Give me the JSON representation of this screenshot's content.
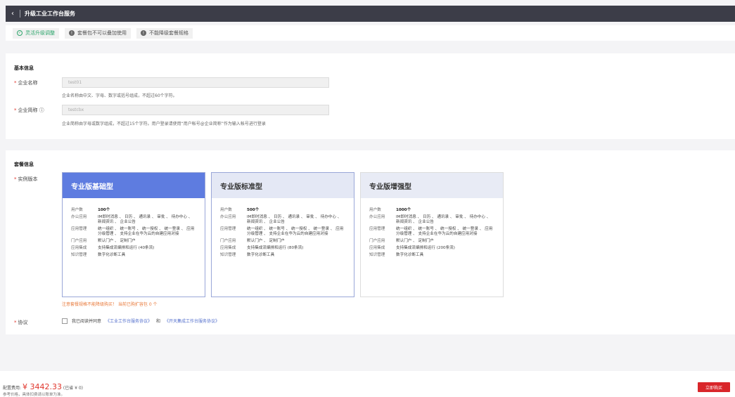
{
  "header": {
    "back_icon": "chevron-left-icon",
    "title": "升级工业工作台服务"
  },
  "tags": [
    {
      "label": "灵活升级调整",
      "icon": "✓"
    },
    {
      "label": "套餐包不可以叠加使用",
      "icon": "!"
    },
    {
      "label": "不能降级套餐规格",
      "icon": "!"
    }
  ],
  "basic": {
    "section_title": "基本信息",
    "company_name_label": "企业名称",
    "company_name_value": "test01",
    "company_name_hint": "企业名称由中文、字母、数字或括号组成，不超过60个字符。",
    "company_abbr_label": "企业简称",
    "company_abbr_value": "testcbx",
    "company_abbr_hint": "企业简称由字母或数字组成，不超过15个字符。用户登录请使用“用户帐号@企业简称”作为输入帐号进行登录"
  },
  "package": {
    "section_title": "套餐信息",
    "edition_label": "实例版本",
    "cards": [
      {
        "name": "专业版基础型",
        "users": "100个",
        "integration": "支持集成流编排和运行 (40条流)"
      },
      {
        "name": "专业版标准型",
        "users": "500个",
        "integration": "支持集成流编排和运行 (80条流)"
      },
      {
        "name": "专业版增强型",
        "users": "1000个",
        "integration": "支持集成流编排和运行 (200条流)"
      }
    ],
    "keys": {
      "users": "用户数",
      "office": "办公应用",
      "app_mgmt": "应用管理",
      "portal": "门户应用",
      "integration": "应用集成",
      "knowledge": "知识管理"
    },
    "common": {
      "office": "IM即时消息 、 日历 、 通讯录 、 审批 、 待办中心 、 新闻资讯 、 企业公告",
      "app_mgmt": "统一组织 、 统一账号 、 统一授权 、 统一登录 、 应用分级管理 、 支持企业在华为云的自建应用对接",
      "portal": "默认门户 、 定制门户",
      "knowledge": "数字化诊断工具"
    },
    "warning": "注意套餐规格不能降级购买！ 当前已购扩容包 0 个",
    "agreement_label": "协议",
    "agreement_text": "我已阅读并同意",
    "agreement_link1": "《工业工作台服务协议》",
    "agreement_and": "和",
    "agreement_link2": "《开天集成工作台服务协议》"
  },
  "footer": {
    "price_label": "配置费用:",
    "price": "¥ 3442.33",
    "saved": "(已省 ¥ 0)",
    "note": "参考价格，具体扣费请以账单为准。",
    "buy_label": "立即购买"
  }
}
